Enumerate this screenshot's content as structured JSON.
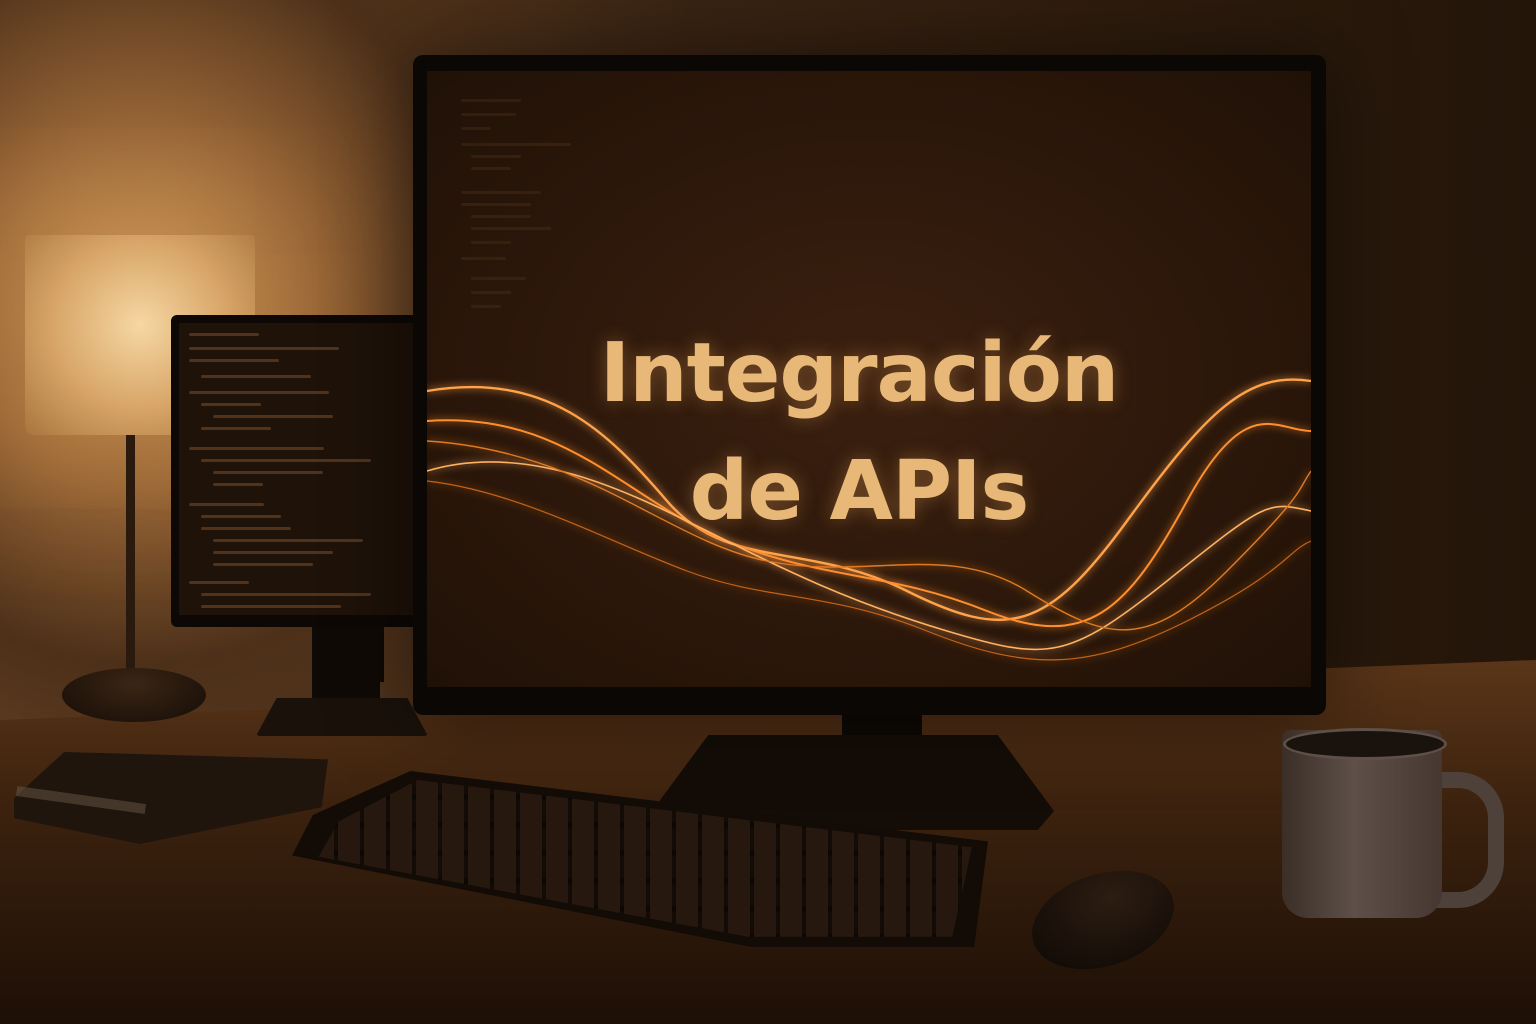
{
  "scene": {
    "main_monitor": {
      "headline_line1": "Integración",
      "headline_line2": "de APIs"
    }
  },
  "colors": {
    "headline": "#e8b878",
    "glow": "#ff9a3a",
    "wall_light": "#c8955a",
    "desk": "#3c220e"
  }
}
